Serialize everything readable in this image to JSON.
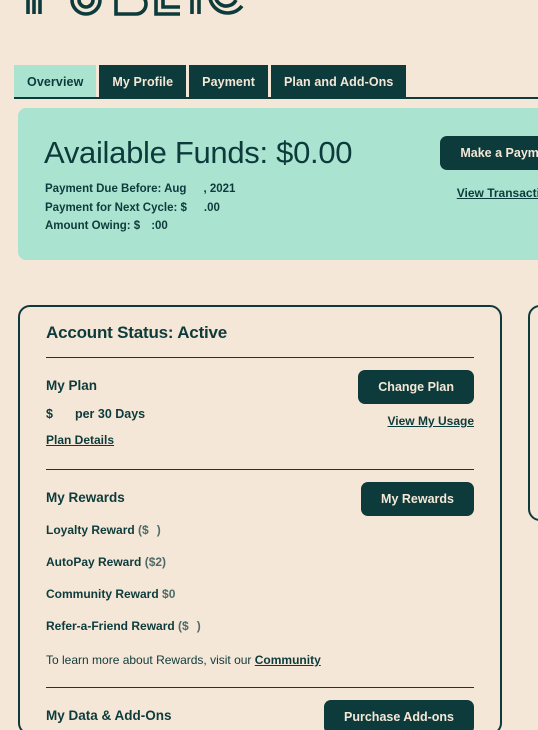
{
  "brand": {
    "logo_text": "PUBLIC",
    "teal": "#0d3b3b",
    "mint": "#abe3d1",
    "cream": "#f5e7d7"
  },
  "tabs": [
    {
      "label": "Overview",
      "active": true
    },
    {
      "label": "My Profile",
      "active": false
    },
    {
      "label": "Payment",
      "active": false
    },
    {
      "label": "Plan and Add-Ons",
      "active": false
    }
  ],
  "funds_banner": {
    "title": "Available Funds: $0.00",
    "line_due_label": "Payment Due Before: Aug",
    "line_due_suffix": ", 2021",
    "line_next_label": "Payment for Next Cycle: $",
    "line_next_suffix": ".00",
    "line_owing_label": "Amount Owing: $",
    "line_owing_suffix": ":00",
    "primary_button": "Make a Payment",
    "secondary_link": "View Transactions"
  },
  "account_card": {
    "title": "Account Status: Active",
    "plan": {
      "heading": "My Plan",
      "price_prefix": "$",
      "price_suffix": "per 30 Days",
      "details_link": "Plan Details",
      "change_button": "Change Plan",
      "usage_link": "View My Usage"
    },
    "rewards": {
      "heading": "My Rewards",
      "button": "My Rewards",
      "items": [
        {
          "name": "Loyalty Reward",
          "amount_prefix": "($",
          "amount_suffix": ")"
        },
        {
          "name": "AutoPay Reward",
          "amount_prefix": "($2",
          "amount_suffix": ")"
        },
        {
          "name": "Community Reward",
          "amount_prefix": "$0",
          "amount_suffix": ""
        },
        {
          "name": "Refer-a-Friend Reward",
          "amount_prefix": "($",
          "amount_suffix": ")"
        }
      ],
      "note_prefix": "To learn more about Rewards, visit our ",
      "note_link": "Community"
    },
    "addons": {
      "heading": "My Data & Add-Ons",
      "button": "Purchase Add-ons"
    }
  }
}
